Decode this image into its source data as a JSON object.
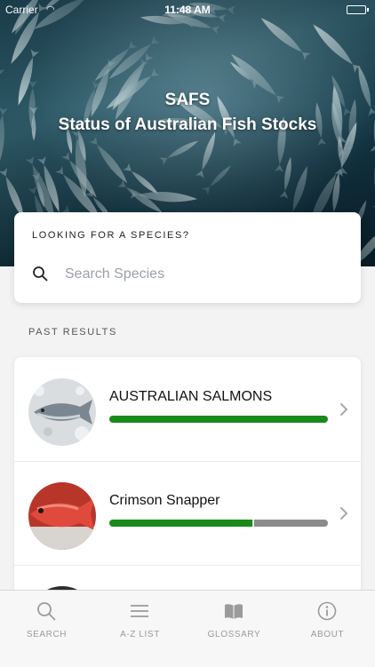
{
  "status_bar": {
    "carrier": "Carrier",
    "time": "11:48 AM"
  },
  "hero": {
    "title": "SAFS",
    "subtitle": "Status of Australian Fish Stocks"
  },
  "search": {
    "label": "LOOKING FOR A SPECIES?",
    "placeholder": "Search Species",
    "value": ""
  },
  "past_results": {
    "label": "PAST RESULTS",
    "items": [
      {
        "name": "AUSTRALIAN SALMONS",
        "status_segments": [
          {
            "fraction": 1.0,
            "color": "#1a8a1a"
          }
        ]
      },
      {
        "name": "Crimson Snapper",
        "status_segments": [
          {
            "fraction": 0.66,
            "color": "#1a8a1a"
          },
          {
            "fraction": 0.34,
            "color": "#8c8c8c"
          }
        ]
      }
    ]
  },
  "tabs": [
    {
      "label": "SEARCH",
      "icon": "search-icon"
    },
    {
      "label": "A-Z LIST",
      "icon": "list-icon"
    },
    {
      "label": "GLOSSARY",
      "icon": "book-icon"
    },
    {
      "label": "ABOUT",
      "icon": "info-icon"
    }
  ],
  "colors": {
    "accent_green": "#1a8a1a",
    "neutral_grey": "#8c8c8c",
    "tab_inactive": "#9b9b9b"
  }
}
